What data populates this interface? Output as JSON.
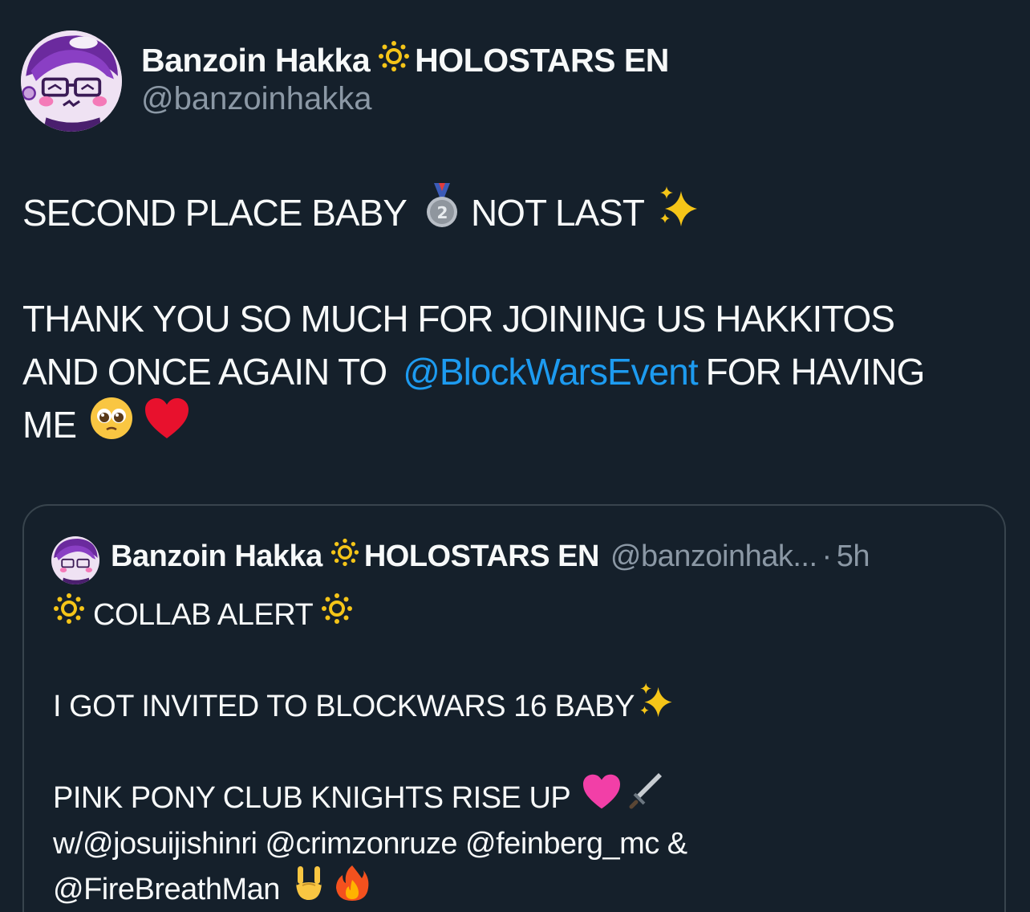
{
  "author": {
    "display_name": "Banzoin Hakka",
    "badge_icon": "sun-icon",
    "affiliation": "HOLOSTARS EN",
    "handle": "@banzoinhakka"
  },
  "tweet": {
    "line1_a": "SECOND PLACE BABY",
    "line1_b": "NOT LAST",
    "line2": "THANK YOU SO MUCH FOR JOINING US HAKKITOS",
    "line3_a": "AND ONCE AGAIN TO",
    "line3_mention": "@BlockWarsEvent",
    "line3_b": "FOR HAVING",
    "line4": "ME",
    "emojis": [
      "second-place-medal-icon",
      "sparkles-icon",
      "pleading-face-icon",
      "red-heart-icon"
    ]
  },
  "quoted_tweet": {
    "display_name": "Banzoin Hakka",
    "affiliation": "HOLOSTARS EN",
    "handle": "@banzoinhak...",
    "separator": "·",
    "time": "5h",
    "line1": "COLLAB ALERT",
    "line2": "I GOT INVITED TO BLOCKWARS 16 BABY",
    "line3": "PINK PONY CLUB KNIGHTS RISE UP",
    "line4": "w/@josuijishinri @crimzonruze @feinberg_mc &",
    "line5": "@FireBreathMan",
    "emojis": [
      "sparkles-icon",
      "pink-heart-icon",
      "dagger-icon",
      "rock-on-hand-icon",
      "fire-icon"
    ]
  },
  "colors": {
    "background": "#15202b",
    "text": "#f7f9f9",
    "secondary_text": "#8b98a5",
    "link": "#1d9bf0",
    "quote_border": "#38444d"
  }
}
